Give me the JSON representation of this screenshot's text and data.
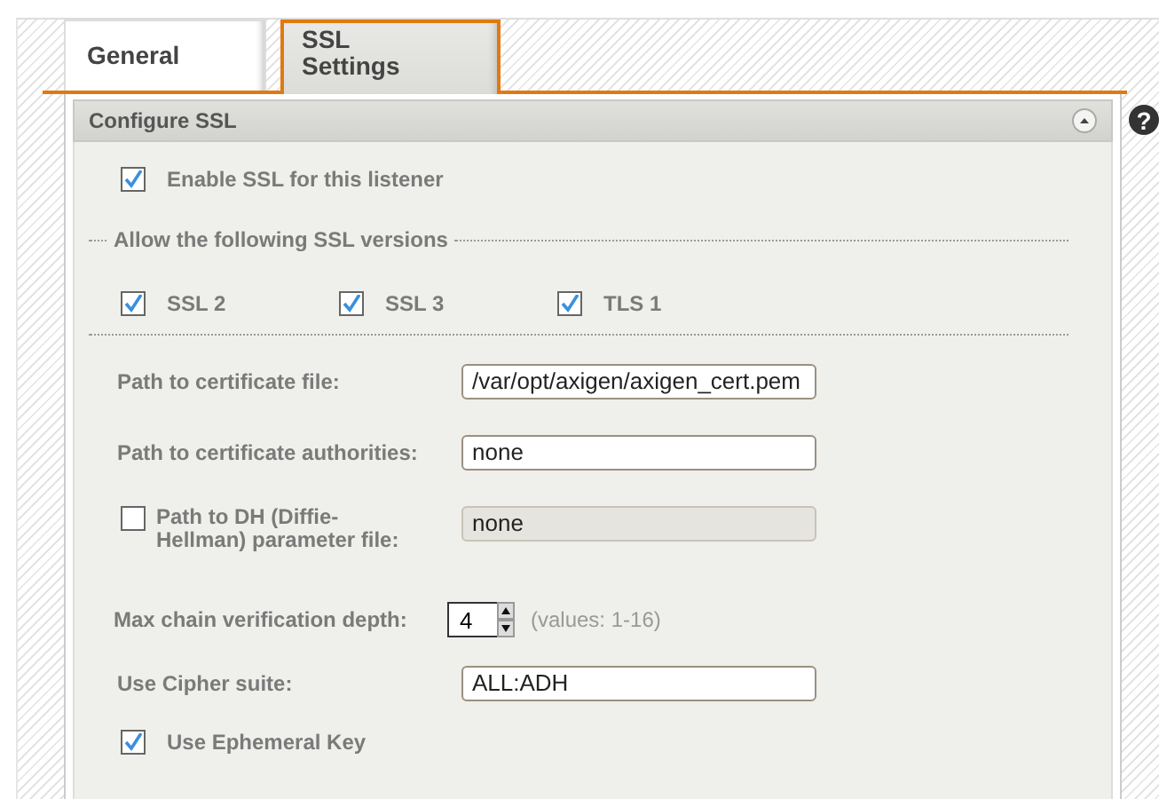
{
  "tabs": [
    {
      "label": "General",
      "selected": false
    },
    {
      "label": "SSL Settings",
      "selected": true
    }
  ],
  "panel": {
    "title": "Configure SSL",
    "expanded": true,
    "help": "?"
  },
  "enable_ssl": {
    "label": "Enable SSL for this listener",
    "checked": true
  },
  "versions": {
    "legend": "Allow the following SSL versions",
    "items": [
      {
        "label": "SSL 2",
        "checked": true
      },
      {
        "label": "SSL 3",
        "checked": true
      },
      {
        "label": "TLS 1",
        "checked": true
      }
    ]
  },
  "fields": [
    {
      "kind": "text",
      "label": "Path to certificate file:",
      "value": "/var/opt/axigen/axigen_cert.pem",
      "disabled": false
    },
    {
      "kind": "text",
      "label": "Path to certificate authorities:",
      "value": "none",
      "disabled": false
    },
    {
      "kind": "checktext",
      "label": "Path to DH (Diffie-Hellman) parameter file:",
      "value": "none",
      "checked": false,
      "disabled": true
    },
    {
      "kind": "spinner",
      "label": "Max chain verification depth:",
      "value": "4",
      "hint": "(values: 1-16)"
    },
    {
      "kind": "text",
      "label": "Use Cipher suite:",
      "value": "ALL:ADH",
      "disabled": false
    },
    {
      "kind": "check",
      "label": "Use Ephemeral Key",
      "checked": true
    }
  ]
}
